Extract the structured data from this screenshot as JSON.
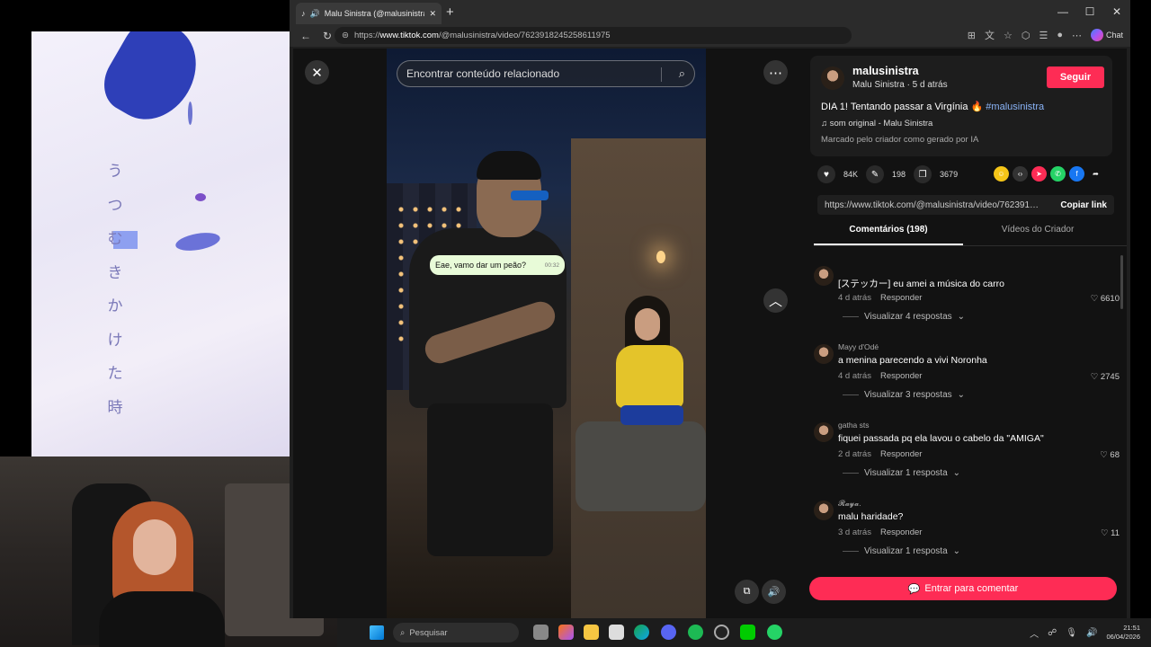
{
  "left_art": {
    "vertical_text": [
      "う",
      "つ",
      "む",
      "き",
      "か",
      "け",
      "た",
      "時"
    ]
  },
  "browser": {
    "tab_title": "Malu Sinistra (@malusinistra)",
    "url_prefix": "https://",
    "url_host": "www.tiktok.com",
    "url_path": "/@malusinistra/video/7623918245258611975",
    "chat_label": "Chat"
  },
  "viewer": {
    "search_placeholder": "Encontrar conteúdo relacionado",
    "bubble_text": "Eae, vamo dar um peão?",
    "bubble_time": "00:32",
    "watermark": "Sinistra"
  },
  "panel": {
    "username": "malusinistra",
    "user_sub": "Malu Sinistra · 5 d atrás",
    "follow_label": "Seguir",
    "description": "DIA 1! Tentando passar a Virgínia 🔥",
    "hashtag": "#malusinistra",
    "sound": "som original - Malu Sinistra",
    "ai_label": "Marcado pelo criador como gerado por IA",
    "likes": "84K",
    "comments_count": "198",
    "saves": "3679",
    "link": "https://www.tiktok.com/@malusinistra/video/7623918...",
    "copy_label": "Copiar link",
    "tab_comments": "Comentários (198)",
    "tab_creator": "Vídeos do Criador",
    "comment_cta": "Entrar para comentar"
  },
  "comments": [
    {
      "user": "",
      "text": "[ステッカー] eu amei a música do carro",
      "time": "4 d atrás",
      "reply": "Responder",
      "likes": "6610",
      "more": "Visualizar 4 respostas"
    },
    {
      "user": "Mayy d'Odé",
      "text": "a menina parecendo a vivi Noronha",
      "time": "4 d atrás",
      "reply": "Responder",
      "likes": "2745",
      "more": "Visualizar 3 respostas"
    },
    {
      "user": "gatha sts",
      "text": "fiquei passada pq ela lavou o cabelo da \"AMIGA\"",
      "time": "2 d atrás",
      "reply": "Responder",
      "likes": "68",
      "more": "Visualizar 1 resposta"
    },
    {
      "user": "𝓡𝓪𝔂𝓪.",
      "text": "malu haridade?",
      "time": "3 d atrás",
      "reply": "Responder",
      "likes": "11",
      "more": "Visualizar 1 resposta"
    }
  ],
  "taskbar": {
    "search_label": "Pesquisar",
    "time": "21:51",
    "date": "06/04/2026"
  },
  "colors": {
    "accent": "#fe2c55",
    "hashtag": "#8ab4f8"
  }
}
